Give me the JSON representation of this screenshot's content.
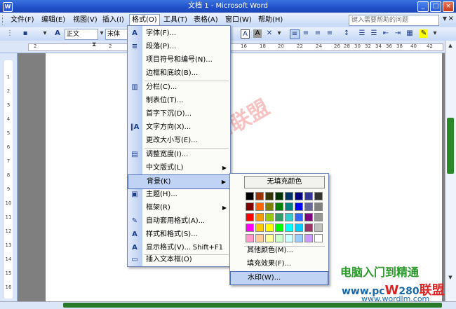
{
  "window": {
    "title": "文档 1 - Microsoft Word",
    "min": "_",
    "max": "□",
    "close": "×"
  },
  "menubar": {
    "items": [
      "文件(F)",
      "编辑(E)",
      "视图(V)",
      "插入(I)",
      "格式(O)",
      "工具(T)",
      "表格(A)",
      "窗口(W)",
      "帮助(H)"
    ],
    "help_placeholder": "键入需要帮助的问题",
    "close": "×"
  },
  "toolbar": {
    "style": "正文",
    "font": "宋体",
    "style_icon": "A",
    "bold_a": "A"
  },
  "ruler": {
    "top_numbers": [
      "2",
      "2",
      "4",
      "6",
      "8",
      "10",
      "12",
      "14",
      "16",
      "18",
      "20",
      "22",
      "24",
      "26",
      "28",
      "30",
      "32",
      "34",
      "36",
      "38",
      "40",
      "42"
    ],
    "left_numbers": [
      "1",
      "2",
      "3",
      "4",
      "5",
      "6",
      "7",
      "8",
      "9",
      "10",
      "11",
      "12",
      "13",
      "14",
      "15",
      "16"
    ]
  },
  "format_menu": {
    "items": [
      {
        "label": "字体(F)...",
        "icon": "A"
      },
      {
        "label": "段落(P)...",
        "icon": "≡"
      },
      {
        "label": "项目符号和编号(N)...",
        "icon": ""
      },
      {
        "label": "边框和底纹(B)...",
        "icon": ""
      },
      {
        "label": "分栏(C)...",
        "icon": "▥"
      },
      {
        "label": "制表位(T)...",
        "icon": ""
      },
      {
        "label": "首字下沉(D)...",
        "icon": ""
      },
      {
        "label": "文字方向(X)...",
        "icon": "‖A"
      },
      {
        "label": "更改大小写(E)...",
        "icon": ""
      },
      {
        "label": "调整宽度(I)...",
        "icon": "▤"
      },
      {
        "label": "中文版式(L)",
        "icon": ""
      },
      {
        "label": "背景(K)",
        "icon": ""
      },
      {
        "label": "主题(H)...",
        "icon": "▣"
      },
      {
        "label": "框架(R)",
        "icon": ""
      },
      {
        "label": "自动套用格式(A)...",
        "icon": "✎"
      },
      {
        "label": "样式和格式(S)...",
        "icon": "A"
      },
      {
        "label": "显示格式(V)...",
        "icon": "A"
      },
      {
        "label": "插入文本框(O)",
        "icon": "▭"
      }
    ],
    "display_shortcut": "Shift+F1"
  },
  "color_menu": {
    "no_fill": "无填充颜色",
    "swatches": [
      [
        "#000000",
        "#993300",
        "#333300",
        "#003300",
        "#003366",
        "#000080",
        "#333399",
        "#333333"
      ],
      [
        "#800000",
        "#FF6600",
        "#808000",
        "#008000",
        "#008080",
        "#0000FF",
        "#666699",
        "#808080"
      ],
      [
        "#FF0000",
        "#FF9900",
        "#99CC00",
        "#339966",
        "#33CCCC",
        "#3366FF",
        "#800080",
        "#969696"
      ],
      [
        "#FF00FF",
        "#FFCC00",
        "#FFFF00",
        "#00FF00",
        "#00FFFF",
        "#00CCFF",
        "#993366",
        "#C0C0C0"
      ],
      [
        "#FF99CC",
        "#FFCC99",
        "#FFFF99",
        "#CCFFCC",
        "#CCFFFF",
        "#99CCFF",
        "#CC99FF",
        "#FFFFFF"
      ]
    ],
    "more_colors": "其他颜色(M)...",
    "fill_effects": "填充效果(F)...",
    "watermark": "水印(W)..."
  },
  "overlay": {
    "watermark": "rd联盟",
    "brand_line1": "电脑入门到精通",
    "brand_line2_pre": "www.pc",
    "brand_line2_w": "W",
    "brand_line2_mid": "280",
    "brand_line2_post": "联盟",
    "brand_line3": "www.wordlm.com"
  }
}
